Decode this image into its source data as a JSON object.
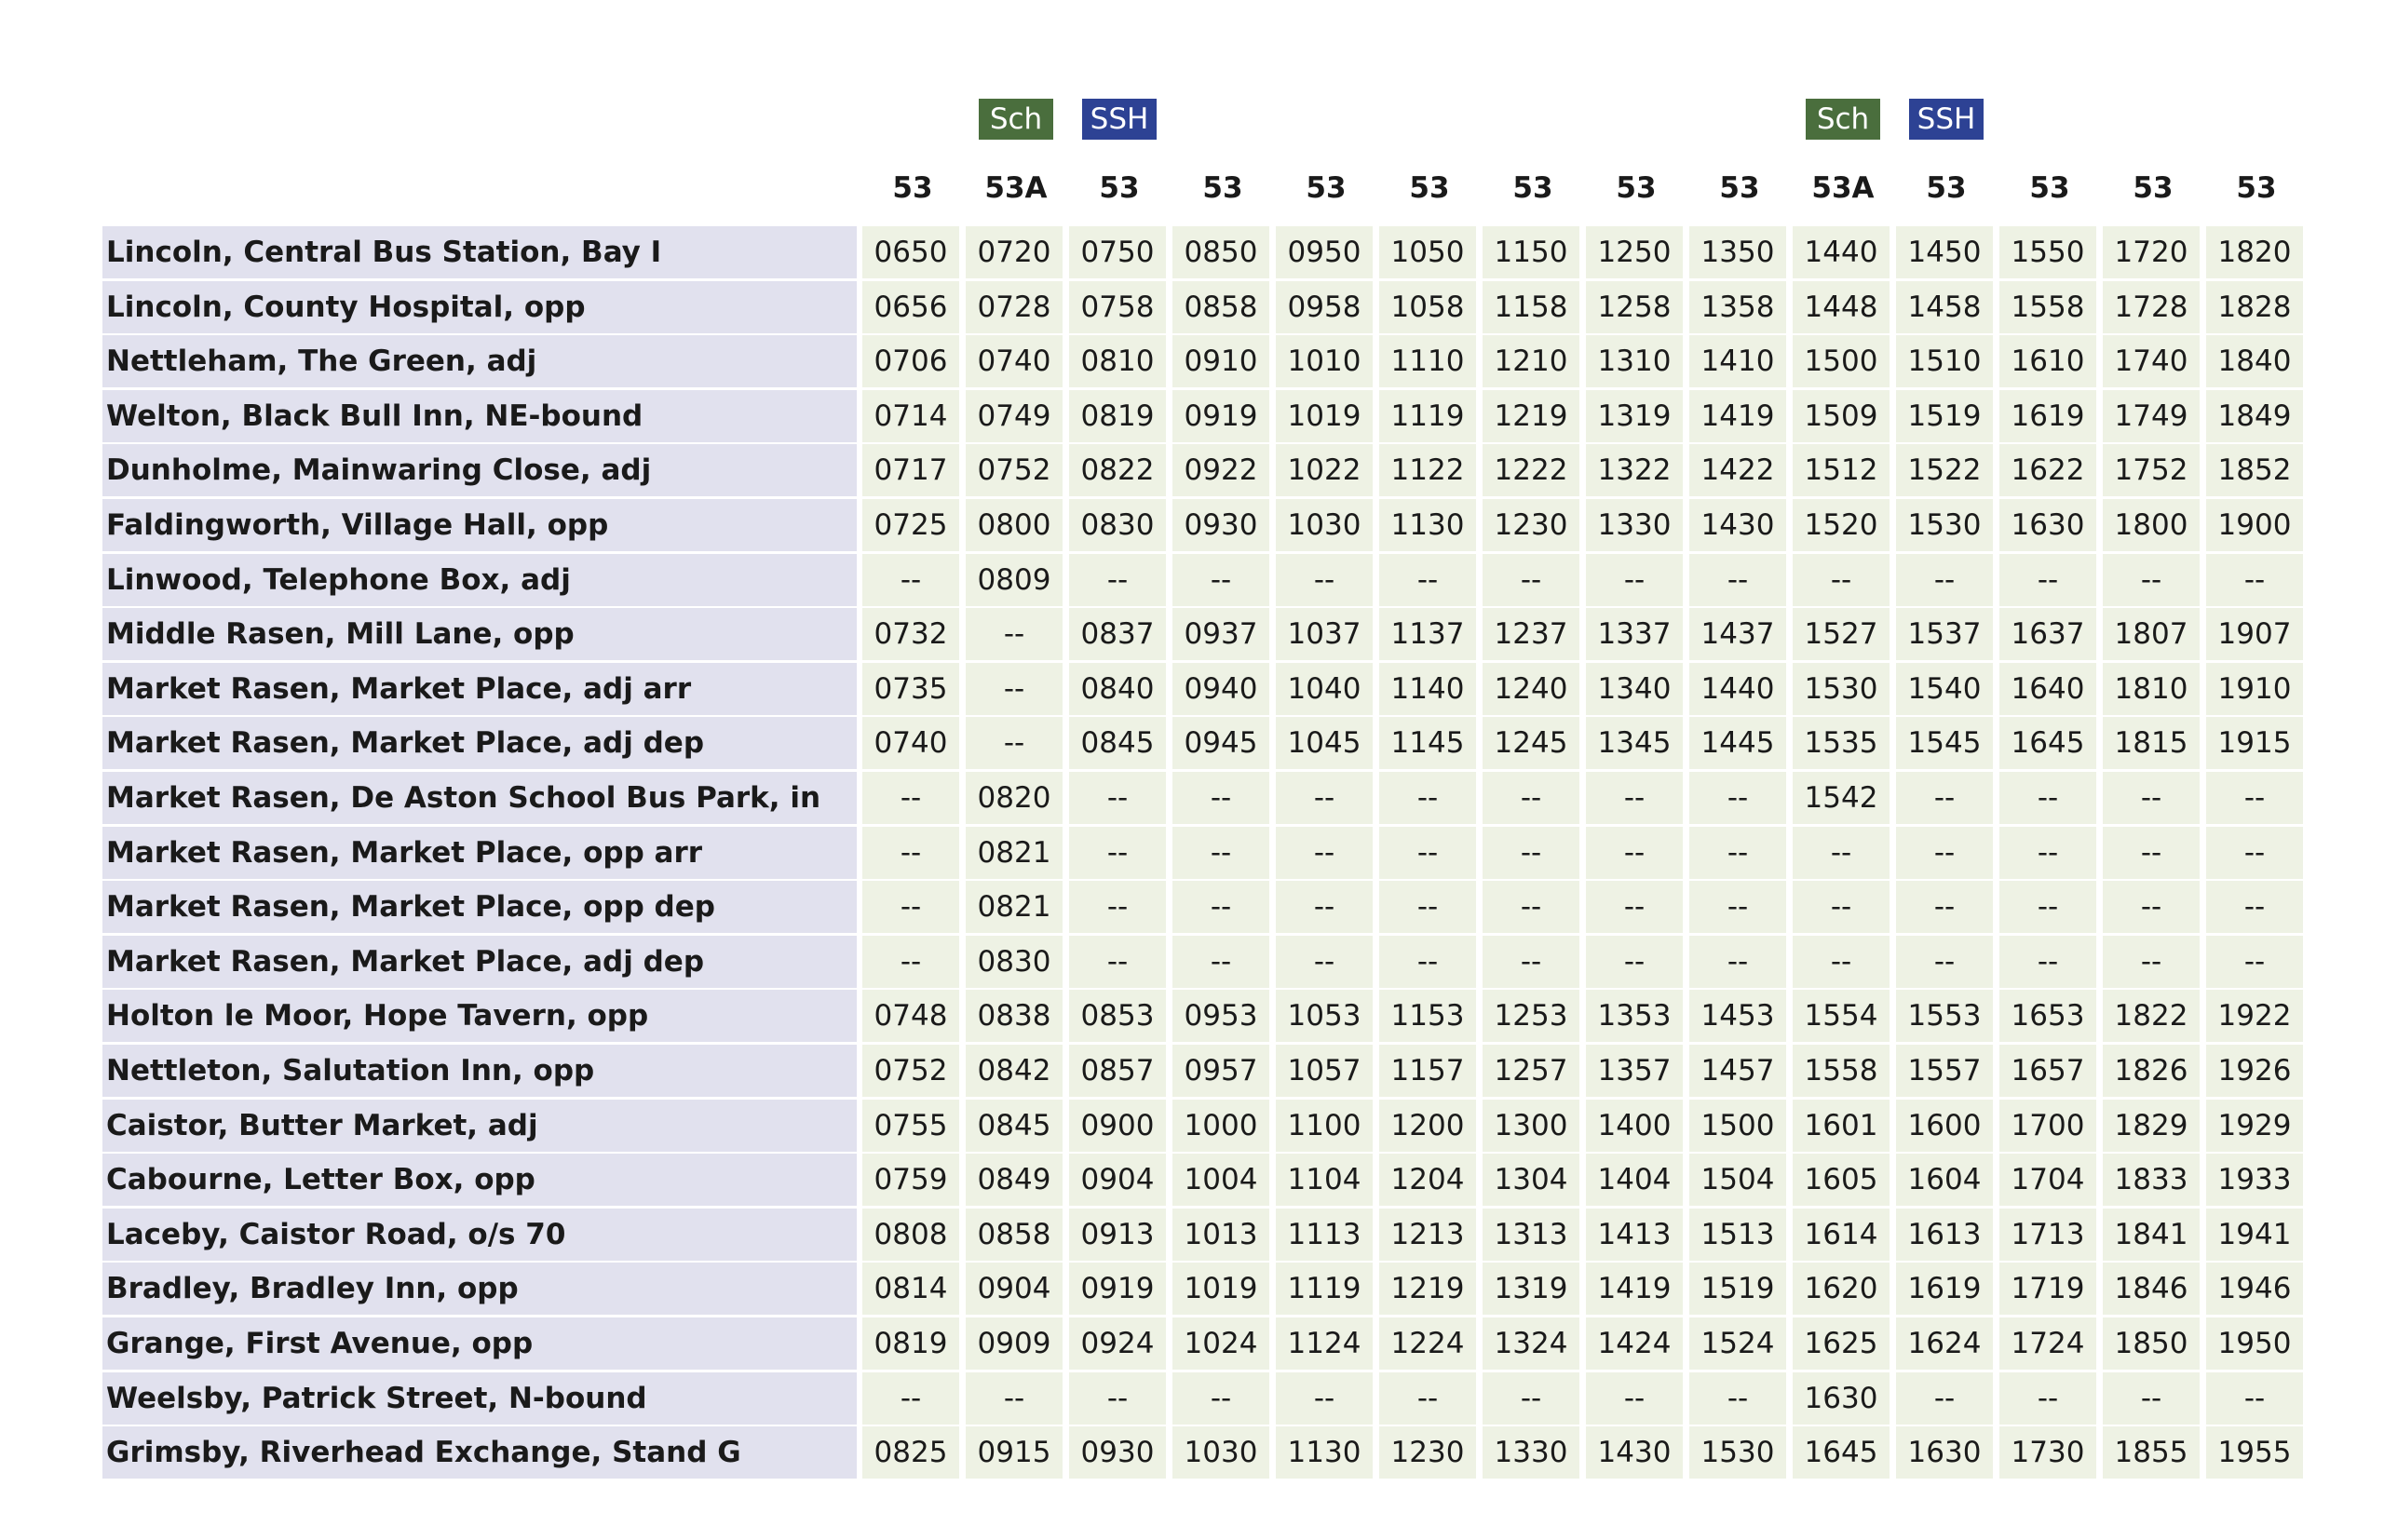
{
  "badges": [
    {
      "label": "Sch",
      "column": 1,
      "kind": "sch",
      "color": "#4a6e3d"
    },
    {
      "label": "SSH",
      "column": 2,
      "kind": "ssh",
      "color": "#2d4294"
    },
    {
      "label": "Sch",
      "column": 9,
      "kind": "sch",
      "color": "#4a6e3d"
    },
    {
      "label": "SSH",
      "column": 10,
      "kind": "ssh",
      "color": "#2d4294"
    }
  ],
  "routes": [
    "53",
    "53A",
    "53",
    "53",
    "53",
    "53",
    "53",
    "53",
    "53",
    "53A",
    "53",
    "53",
    "53",
    "53"
  ],
  "stops": [
    {
      "name": "Lincoln, Central Bus Station, Bay I",
      "times": [
        "0650",
        "0720",
        "0750",
        "0850",
        "0950",
        "1050",
        "1150",
        "1250",
        "1350",
        "1440",
        "1450",
        "1550",
        "1720",
        "1820"
      ]
    },
    {
      "name": "Lincoln, County Hospital, opp",
      "times": [
        "0656",
        "0728",
        "0758",
        "0858",
        "0958",
        "1058",
        "1158",
        "1258",
        "1358",
        "1448",
        "1458",
        "1558",
        "1728",
        "1828"
      ]
    },
    {
      "name": "Nettleham, The Green, adj",
      "times": [
        "0706",
        "0740",
        "0810",
        "0910",
        "1010",
        "1110",
        "1210",
        "1310",
        "1410",
        "1500",
        "1510",
        "1610",
        "1740",
        "1840"
      ]
    },
    {
      "name": "Welton, Black Bull Inn, NE-bound",
      "times": [
        "0714",
        "0749",
        "0819",
        "0919",
        "1019",
        "1119",
        "1219",
        "1319",
        "1419",
        "1509",
        "1519",
        "1619",
        "1749",
        "1849"
      ]
    },
    {
      "name": "Dunholme, Mainwaring Close, adj",
      "times": [
        "0717",
        "0752",
        "0822",
        "0922",
        "1022",
        "1122",
        "1222",
        "1322",
        "1422",
        "1512",
        "1522",
        "1622",
        "1752",
        "1852"
      ]
    },
    {
      "name": "Faldingworth, Village Hall, opp",
      "times": [
        "0725",
        "0800",
        "0830",
        "0930",
        "1030",
        "1130",
        "1230",
        "1330",
        "1430",
        "1520",
        "1530",
        "1630",
        "1800",
        "1900"
      ]
    },
    {
      "name": "Linwood, Telephone Box, adj",
      "times": [
        "--",
        "0809",
        "--",
        "--",
        "--",
        "--",
        "--",
        "--",
        "--",
        "--",
        "--",
        "--",
        "--",
        "--"
      ]
    },
    {
      "name": "Middle Rasen, Mill Lane, opp",
      "times": [
        "0732",
        "--",
        "0837",
        "0937",
        "1037",
        "1137",
        "1237",
        "1337",
        "1437",
        "1527",
        "1537",
        "1637",
        "1807",
        "1907"
      ]
    },
    {
      "name": "Market Rasen, Market Place, adj arr",
      "times": [
        "0735",
        "--",
        "0840",
        "0940",
        "1040",
        "1140",
        "1240",
        "1340",
        "1440",
        "1530",
        "1540",
        "1640",
        "1810",
        "1910"
      ]
    },
    {
      "name": "Market Rasen, Market Place, adj dep",
      "times": [
        "0740",
        "--",
        "0845",
        "0945",
        "1045",
        "1145",
        "1245",
        "1345",
        "1445",
        "1535",
        "1545",
        "1645",
        "1815",
        "1915"
      ]
    },
    {
      "name": "Market Rasen, De Aston School Bus Park, in",
      "times": [
        "--",
        "0820",
        "--",
        "--",
        "--",
        "--",
        "--",
        "--",
        "--",
        "1542",
        "--",
        "--",
        "--",
        "--"
      ]
    },
    {
      "name": "Market Rasen, Market Place, opp arr",
      "times": [
        "--",
        "0821",
        "--",
        "--",
        "--",
        "--",
        "--",
        "--",
        "--",
        "--",
        "--",
        "--",
        "--",
        "--"
      ]
    },
    {
      "name": "Market Rasen, Market Place, opp dep",
      "times": [
        "--",
        "0821",
        "--",
        "--",
        "--",
        "--",
        "--",
        "--",
        "--",
        "--",
        "--",
        "--",
        "--",
        "--"
      ]
    },
    {
      "name": "Market Rasen, Market Place, adj dep",
      "times": [
        "--",
        "0830",
        "--",
        "--",
        "--",
        "--",
        "--",
        "--",
        "--",
        "--",
        "--",
        "--",
        "--",
        "--"
      ]
    },
    {
      "name": "Holton le Moor, Hope Tavern, opp",
      "times": [
        "0748",
        "0838",
        "0853",
        "0953",
        "1053",
        "1153",
        "1253",
        "1353",
        "1453",
        "1554",
        "1553",
        "1653",
        "1822",
        "1922"
      ]
    },
    {
      "name": "Nettleton, Salutation Inn, opp",
      "times": [
        "0752",
        "0842",
        "0857",
        "0957",
        "1057",
        "1157",
        "1257",
        "1357",
        "1457",
        "1558",
        "1557",
        "1657",
        "1826",
        "1926"
      ]
    },
    {
      "name": "Caistor, Butter Market, adj",
      "times": [
        "0755",
        "0845",
        "0900",
        "1000",
        "1100",
        "1200",
        "1300",
        "1400",
        "1500",
        "1601",
        "1600",
        "1700",
        "1829",
        "1929"
      ]
    },
    {
      "name": "Cabourne, Letter Box, opp",
      "times": [
        "0759",
        "0849",
        "0904",
        "1004",
        "1104",
        "1204",
        "1304",
        "1404",
        "1504",
        "1605",
        "1604",
        "1704",
        "1833",
        "1933"
      ]
    },
    {
      "name": "Laceby, Caistor Road, o/s 70",
      "times": [
        "0808",
        "0858",
        "0913",
        "1013",
        "1113",
        "1213",
        "1313",
        "1413",
        "1513",
        "1614",
        "1613",
        "1713",
        "1841",
        "1941"
      ]
    },
    {
      "name": "Bradley, Bradley Inn, opp",
      "times": [
        "0814",
        "0904",
        "0919",
        "1019",
        "1119",
        "1219",
        "1319",
        "1419",
        "1519",
        "1620",
        "1619",
        "1719",
        "1846",
        "1946"
      ]
    },
    {
      "name": "Grange, First Avenue, opp",
      "times": [
        "0819",
        "0909",
        "0924",
        "1024",
        "1124",
        "1224",
        "1324",
        "1424",
        "1524",
        "1625",
        "1624",
        "1724",
        "1850",
        "1950"
      ]
    },
    {
      "name": "Weelsby, Patrick Street, N-bound",
      "times": [
        "--",
        "--",
        "--",
        "--",
        "--",
        "--",
        "--",
        "--",
        "--",
        "1630",
        "--",
        "--",
        "--",
        "--"
      ]
    },
    {
      "name": "Grimsby, Riverhead Exchange, Stand G",
      "times": [
        "0825",
        "0915",
        "0930",
        "1030",
        "1130",
        "1230",
        "1330",
        "1430",
        "1530",
        "1645",
        "1630",
        "1730",
        "1855",
        "1955"
      ]
    }
  ]
}
